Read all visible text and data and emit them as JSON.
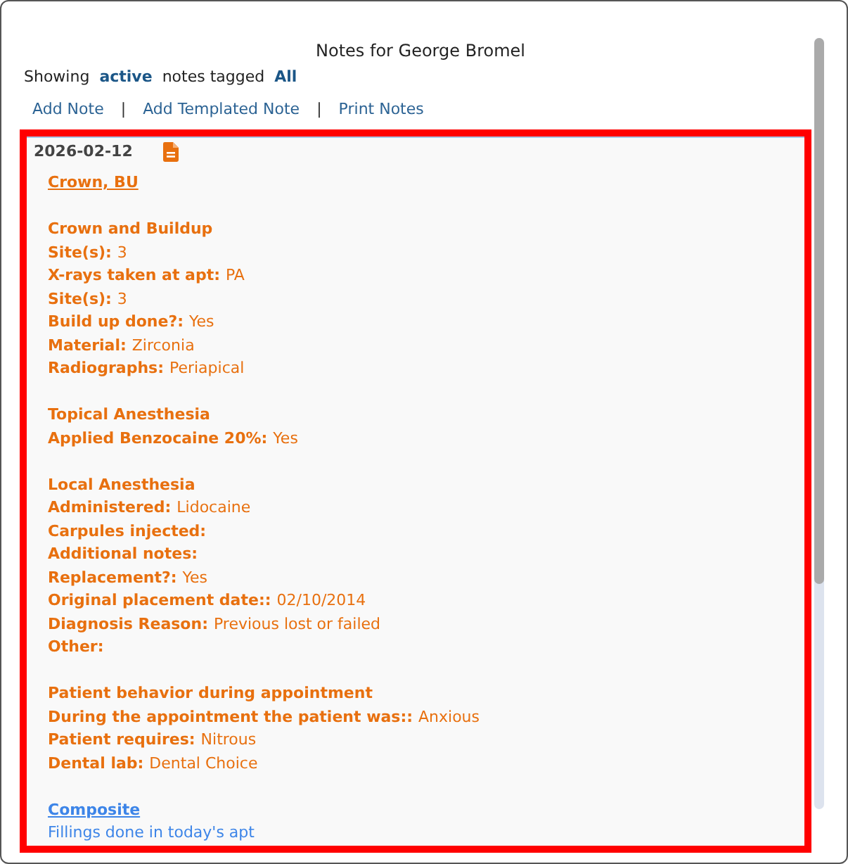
{
  "window": {
    "title": "Notes for George Bromel"
  },
  "filter": {
    "prefix": "Showing",
    "status": "active",
    "middle": "notes tagged",
    "tag": "All"
  },
  "actions": [
    {
      "kind": "link",
      "label": "Add Note"
    },
    {
      "kind": "separator",
      "label": "|"
    },
    {
      "kind": "link",
      "label": "Add Templated Note"
    },
    {
      "kind": "separator",
      "label": "|"
    },
    {
      "kind": "link",
      "label": "Print Notes"
    }
  ],
  "notes": [
    {
      "date": "2026-02-12",
      "highlighted": true,
      "procedures": [
        {
          "title": "Crown, BU",
          "color": "#e8700f",
          "sections": [
            {
              "heading": "Crown and Buildup",
              "fields": [
                {
                  "label": "Site(s):",
                  "value": "3"
                },
                {
                  "label": "X-rays taken at apt:",
                  "value": "PA"
                },
                {
                  "label": "Site(s):",
                  "value": "3"
                },
                {
                  "label": "Build up done?:",
                  "value": "Yes"
                },
                {
                  "label": "Material:",
                  "value": "Zirconia"
                },
                {
                  "label": "Radiographs:",
                  "value": "Periapical"
                }
              ]
            },
            {
              "heading": "Topical Anesthesia",
              "fields": [
                {
                  "label": "Applied Benzocaine 20%:",
                  "value": "Yes"
                }
              ]
            },
            {
              "heading": "Local Anesthesia",
              "fields": [
                {
                  "label": "Administered:",
                  "value": "Lidocaine"
                },
                {
                  "label": "Carpules injected:"
                },
                {
                  "label": "Additional notes:"
                },
                {
                  "label": "Replacement?:",
                  "value": "Yes"
                },
                {
                  "label": "Original placement date::",
                  "value": "02/10/2014"
                },
                {
                  "label": "Diagnosis Reason:",
                  "value": "Previous lost or failed"
                },
                {
                  "label": "Other:"
                }
              ]
            },
            {
              "heading": "Patient behavior during appointment",
              "fields": [
                {
                  "label": "During the appointment the patient was::",
                  "value": "Anxious"
                },
                {
                  "label": "Patient requires:",
                  "value": "Nitrous"
                },
                {
                  "label": "Dental lab:",
                  "value": "Dental Choice"
                }
              ]
            }
          ]
        },
        {
          "title": "Composite",
          "color": "#3d85e8",
          "description": "Fillings done in today's apt"
        }
      ]
    }
  ]
}
